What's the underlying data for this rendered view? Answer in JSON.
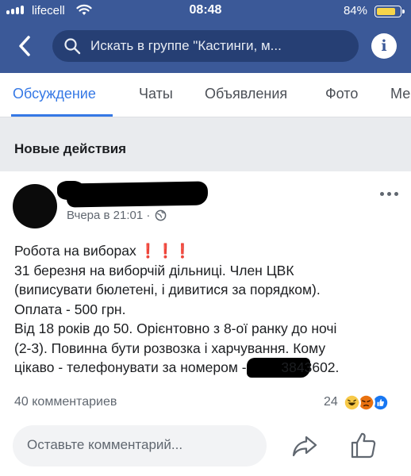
{
  "status_bar": {
    "carrier": "lifecell",
    "time": "08:48",
    "battery_percent": "84%",
    "battery_level": 0.84
  },
  "header": {
    "search_placeholder": "Искать в группе \"Кастинги, м...",
    "info_label": "i"
  },
  "tabs": [
    {
      "label": "Обсуждение",
      "active": true
    },
    {
      "label": "Чаты",
      "active": false
    },
    {
      "label": "Объявления",
      "active": false
    },
    {
      "label": "Фото",
      "active": false
    },
    {
      "label": "Ме",
      "active": false
    }
  ],
  "section": {
    "title": "Новые действия"
  },
  "post": {
    "timestamp": "Вчера в 21:01 ·",
    "body": {
      "line1": "Робота на виборах",
      "line1_emoji": "❗❗❗",
      "line2": "31 березня на виборчій дільниці. Член ЦВК",
      "line3": "(виписувати бюлетені, і дивитися за порядком).",
      "line4": "Оплата - 500 грн.",
      "line5": "Від 18 років до 50. Орієнтовно з 8-ої ранку до ночі",
      "line6": "(2-3). Повинна бути розвозка і харчування. Кому",
      "line7_prefix": "цікаво - телефонувати за номером - ",
      "line7_phone_visible": "3843602."
    },
    "comments_count": "40 комментариев",
    "reactions_count": "24",
    "comment_placeholder": "Оставьте комментарий..."
  },
  "colors": {
    "brand": "#3b5998",
    "accent": "#3578e5",
    "battery": "#f7d54a"
  }
}
